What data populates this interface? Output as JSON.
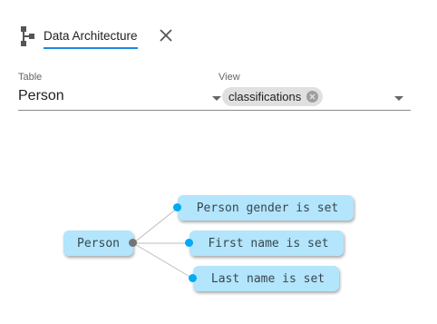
{
  "tab": {
    "label": "Data Architecture",
    "icon": "hierarchy-icon",
    "close_icon": "close-icon"
  },
  "table_field": {
    "label": "Table",
    "value": "Person"
  },
  "view_field": {
    "label": "View",
    "chips": [
      "classifications"
    ]
  },
  "graph": {
    "root": "Person",
    "children": [
      "Person gender is set",
      "First name is set",
      "Last name is set"
    ]
  },
  "colors": {
    "accent": "#1e88e5",
    "node_fill": "#b3e5fc",
    "child_dot": "#03a9f4",
    "root_dot": "#757575"
  }
}
